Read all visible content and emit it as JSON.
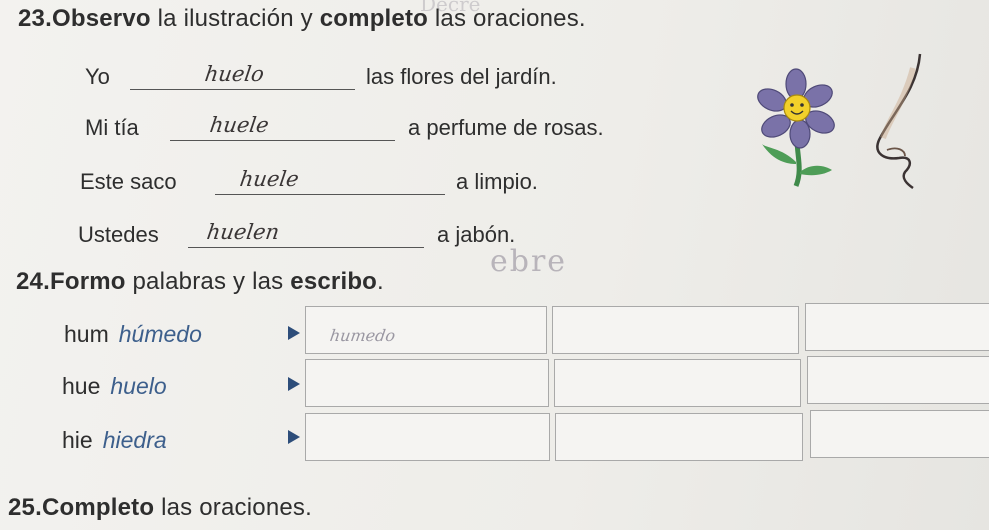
{
  "exercise23": {
    "number": "23.",
    "title_bold": "Observo",
    "title_mid": " la ilustración y ",
    "title_bold2": "completo",
    "title_rest": " las oraciones.",
    "rows": [
      {
        "prefix": "Yo",
        "answer": "huelo",
        "suffix": "las flores del jardín."
      },
      {
        "prefix": "Mi tía",
        "answer": "huele",
        "suffix": "a perfume de rosas."
      },
      {
        "prefix": "Este saco",
        "answer": "huele",
        "suffix": "a limpio."
      },
      {
        "prefix": "Ustedes",
        "answer": "huelen",
        "suffix": "a jabón."
      }
    ]
  },
  "faint_marks": {
    "top": "Decre",
    "side": "ebre"
  },
  "exercise24": {
    "number": "24.",
    "title_bold": "Formo",
    "title_mid": " palabras y las ",
    "title_bold2": "escribo",
    "title_rest": ".",
    "rows": [
      {
        "syllable": "hum",
        "example": "húmedo",
        "written": "humedo"
      },
      {
        "syllable": "hue",
        "example": "huelo",
        "written": ""
      },
      {
        "syllable": "hie",
        "example": "hiedra",
        "written": ""
      }
    ]
  },
  "exercise25": {
    "number": "25.",
    "title_bold": "Completo",
    "title_rest": " las oraciones."
  },
  "colors": {
    "example_blue": "#3d5f8c",
    "arrow": "#2d4d7a",
    "flower_petal": "#7a72a8",
    "flower_center": "#f2d02a",
    "stem": "#3f8a4a"
  },
  "icons": [
    "flower-illustration",
    "nose-illustration",
    "arrow-right-icon"
  ]
}
